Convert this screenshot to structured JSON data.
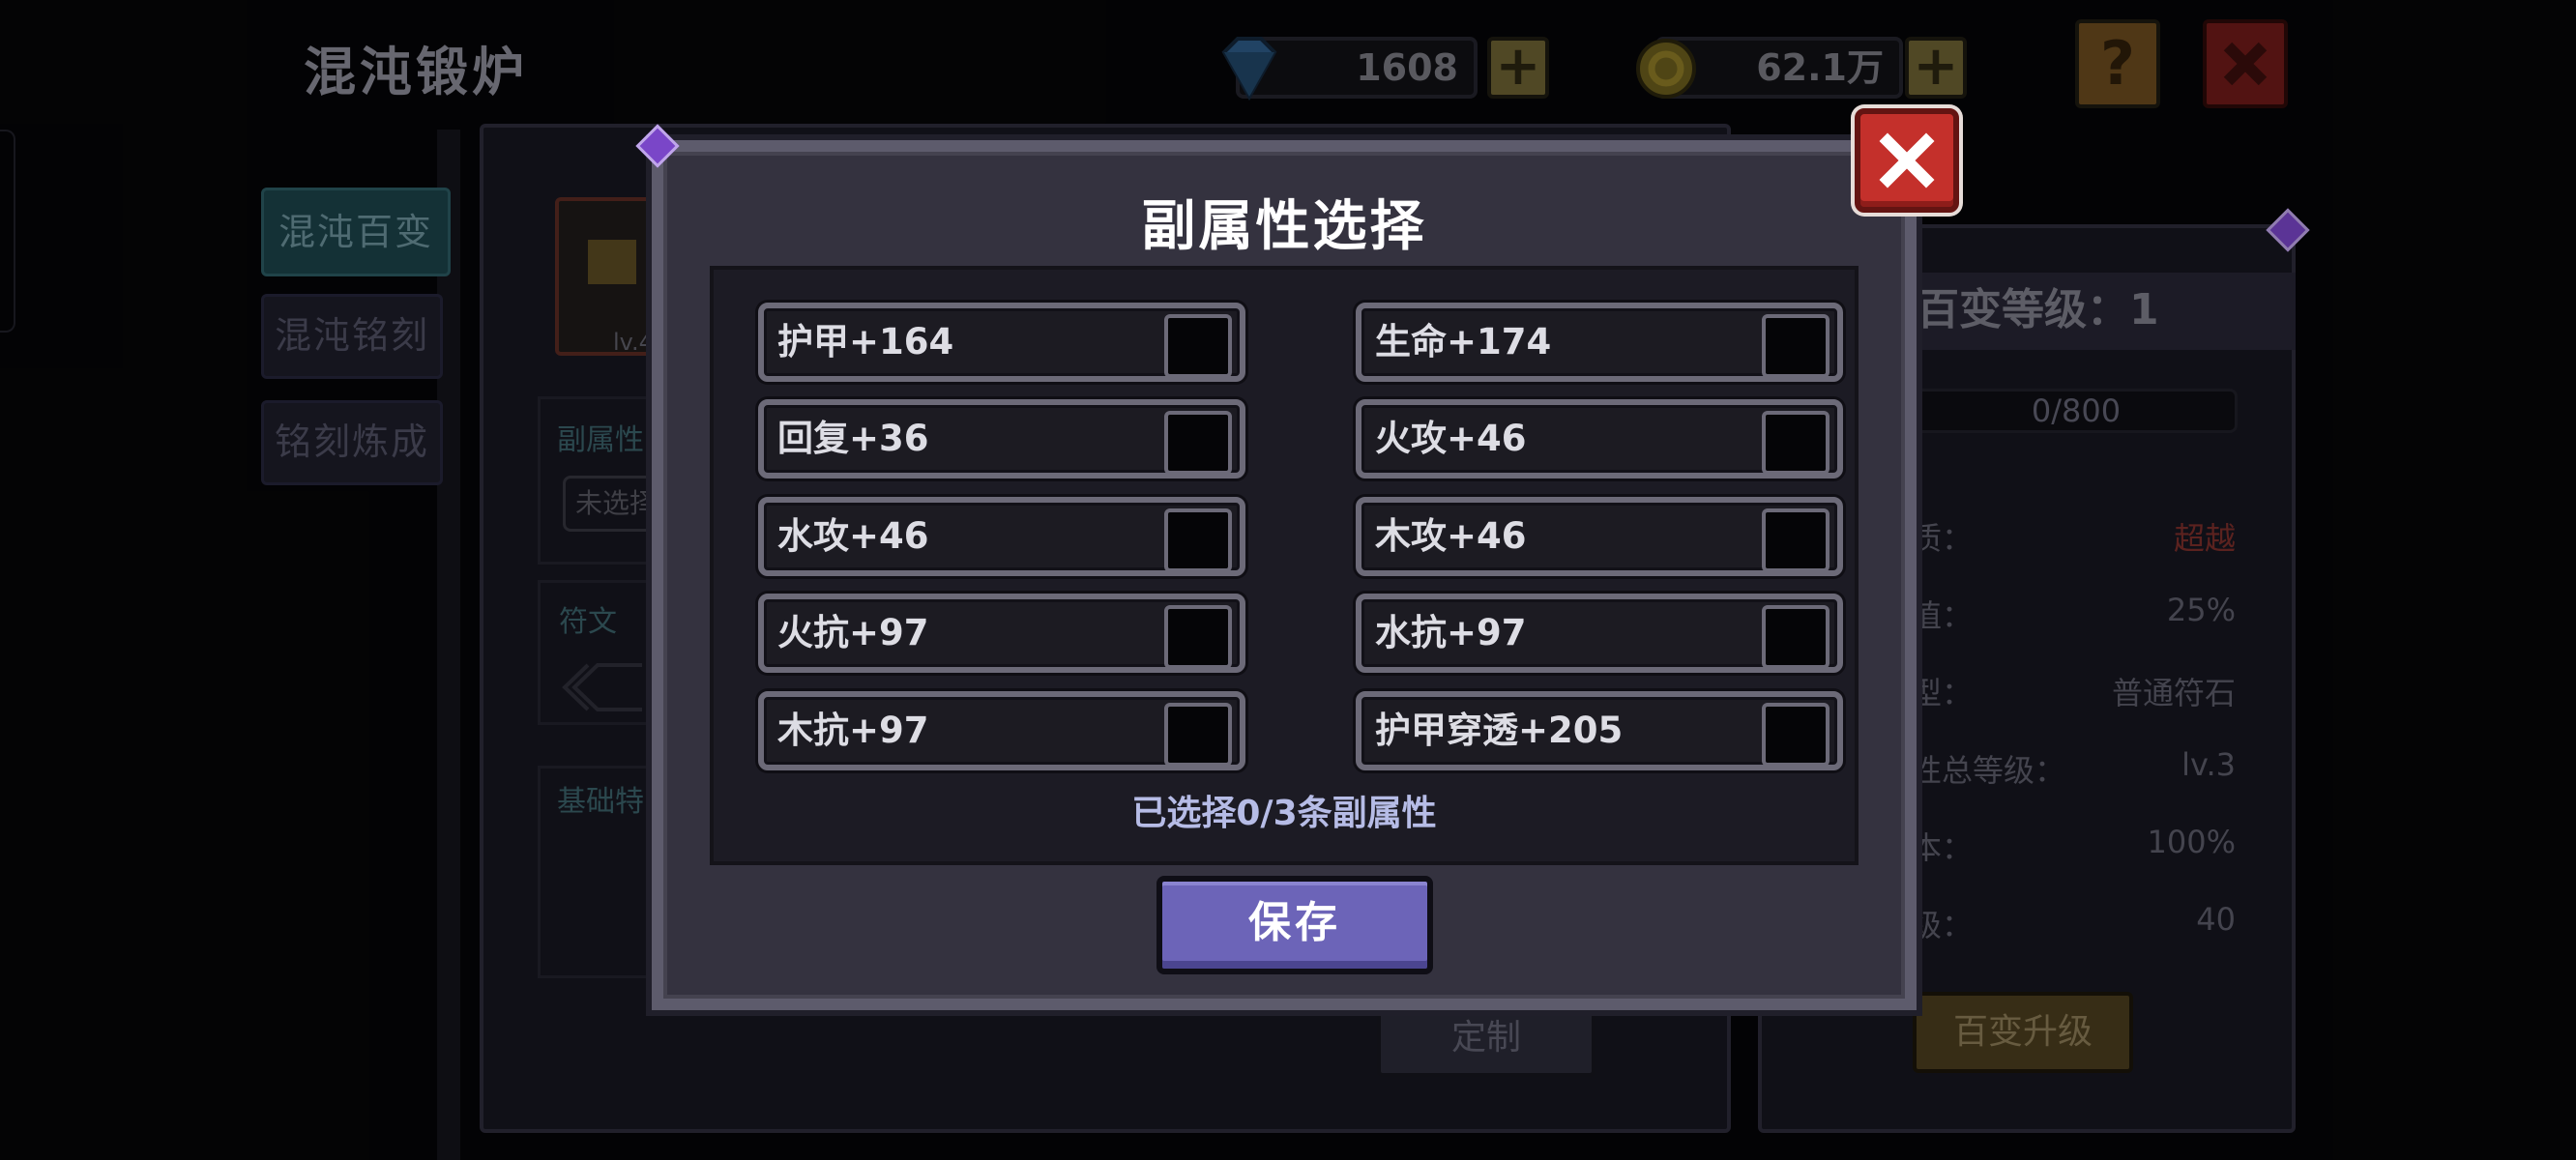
{
  "header": {
    "title": "混沌锻炉",
    "gems": "1608",
    "gold": "62.1万",
    "help_label": "?"
  },
  "sidebar": {
    "items": [
      {
        "label": "混沌百变",
        "active": true
      },
      {
        "label": "混沌铭刻",
        "active": false
      },
      {
        "label": "铭刻炼成",
        "active": false
      }
    ]
  },
  "left_panel": {
    "item_level": "lv.4",
    "sub_attr_label": "副属性",
    "unselected_label": "未选择",
    "rune_label": "符文",
    "base_label": "基础特",
    "custom_button": "定制"
  },
  "right_panel": {
    "level_label": "百变等级：1",
    "exp": "0/800",
    "stats": [
      {
        "label": "质：",
        "value": "超越"
      },
      {
        "label": "值：",
        "value": "25%"
      },
      {
        "label": "型：",
        "value": "普通符石"
      },
      {
        "label": "性总等级：",
        "value": "lv.3"
      },
      {
        "label": "本：",
        "value": "100%"
      },
      {
        "label": "级：",
        "value": "40"
      }
    ],
    "upgrade_button": "百变升级"
  },
  "dialog": {
    "title": "副属性选择",
    "options": [
      {
        "label": "护甲+164",
        "checked": false
      },
      {
        "label": "生命+174",
        "checked": false
      },
      {
        "label": "回复+36",
        "checked": false
      },
      {
        "label": "火攻+46",
        "checked": false
      },
      {
        "label": "水攻+46",
        "checked": false
      },
      {
        "label": "木攻+46",
        "checked": false
      },
      {
        "label": "火抗+97",
        "checked": false
      },
      {
        "label": "水抗+97",
        "checked": false
      },
      {
        "label": "木抗+97",
        "checked": false
      },
      {
        "label": "护甲穿透+205",
        "checked": false
      }
    ],
    "selected_text": "已选择0/3条副属性",
    "save_label": "保存"
  },
  "colors": {
    "accent_value": "#b8453f",
    "save_button": "#6c64b8",
    "close_button": "#c4302b"
  }
}
